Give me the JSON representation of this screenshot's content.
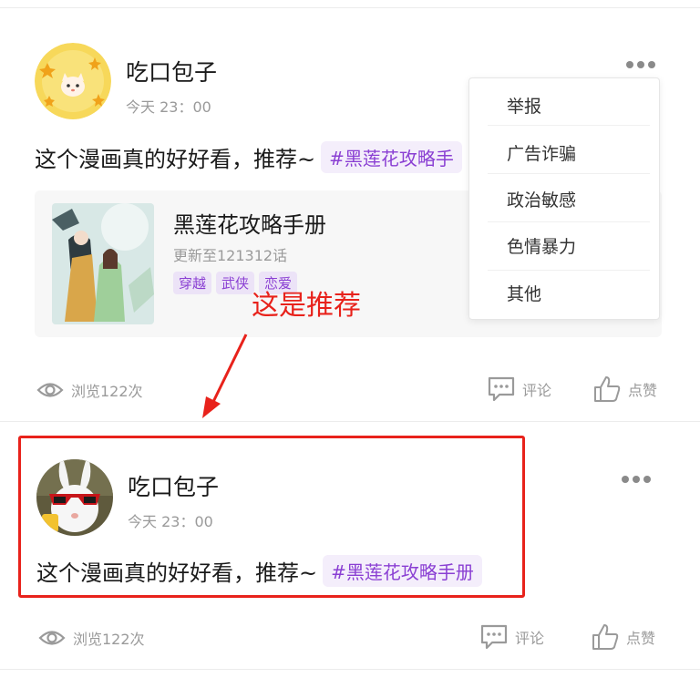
{
  "posts": [
    {
      "username": "吃口包子",
      "time": "今天 23：00",
      "text": "这个漫画真的好好看，推荐~",
      "topic": "#黑莲花攻略手",
      "comic_card": {
        "title": "黑莲花攻略手册",
        "update_info": "更新至121312话",
        "tags": [
          "穿越",
          "武侠",
          "恋爱"
        ]
      },
      "footer": {
        "views": "浏览122次",
        "comment_label": "评论",
        "like_label": "点赞"
      }
    },
    {
      "username": "吃口包子",
      "time": "今天 23：00",
      "text": "这个漫画真的好好看，推荐~",
      "topic": "#黑莲花攻略手册",
      "footer": {
        "views": "浏览122次",
        "comment_label": "评论",
        "like_label": "点赞"
      }
    }
  ],
  "report_menu": {
    "items": [
      "举报",
      "广告诈骗",
      "政治敏感",
      "色情暴力",
      "其他"
    ]
  },
  "annotation": {
    "text": "这是推荐",
    "color": "#e8221b"
  },
  "colors": {
    "topic": "#8a3fd3",
    "annotation_red": "#e8221b",
    "muted": "#9a9a9a"
  }
}
